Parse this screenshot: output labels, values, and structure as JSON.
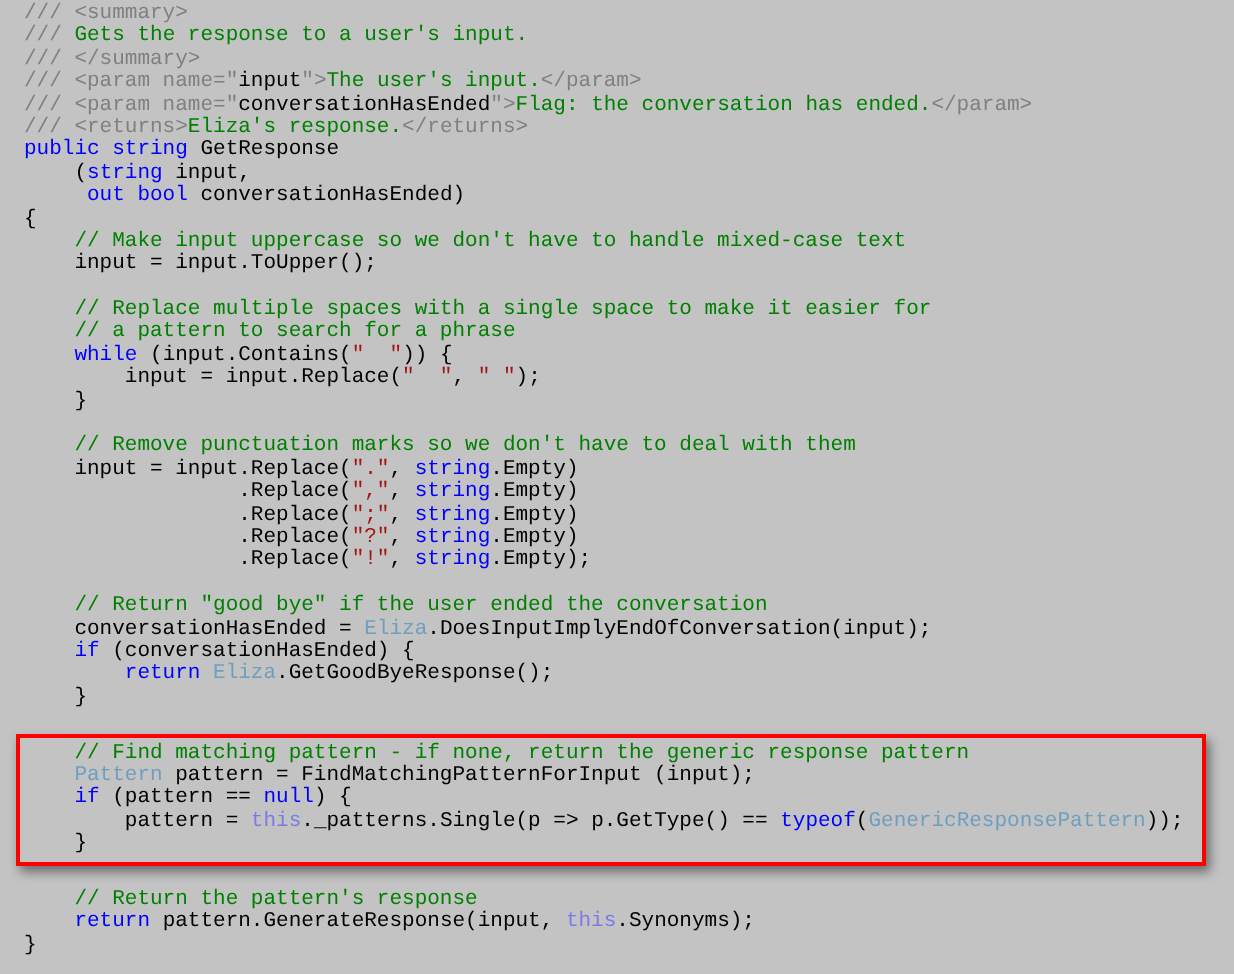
{
  "editor": {
    "sections": [
      {
        "highlighted": false,
        "lines": [
          {
            "kind": "code",
            "tokens": [
              {
                "kind": "doc",
                "text": "/// <summary>"
              }
            ]
          },
          {
            "kind": "code",
            "tokens": [
              {
                "kind": "doc",
                "text": "///"
              },
              {
                "kind": "comment",
                "text": " Gets the response to a user's input."
              }
            ]
          },
          {
            "kind": "code",
            "tokens": [
              {
                "kind": "doc",
                "text": "/// </summary>"
              }
            ]
          },
          {
            "kind": "code",
            "tokens": [
              {
                "kind": "doc",
                "text": "/// <param name=\""
              },
              {
                "kind": "plain",
                "text": "input"
              },
              {
                "kind": "doc",
                "text": "\">"
              },
              {
                "kind": "comment",
                "text": "The user's input."
              },
              {
                "kind": "doc",
                "text": "</param>"
              }
            ]
          },
          {
            "kind": "code",
            "tokens": [
              {
                "kind": "doc",
                "text": "/// <param name=\""
              },
              {
                "kind": "plain",
                "text": "conversationHasEnded"
              },
              {
                "kind": "doc",
                "text": "\">"
              },
              {
                "kind": "comment",
                "text": "Flag: the conversation has ended."
              },
              {
                "kind": "doc",
                "text": "</param>"
              }
            ]
          },
          {
            "kind": "code",
            "tokens": [
              {
                "kind": "doc",
                "text": "/// <returns>"
              },
              {
                "kind": "comment",
                "text": "Eliza's response."
              },
              {
                "kind": "doc",
                "text": "</returns>"
              }
            ]
          },
          {
            "kind": "code",
            "tokens": [
              {
                "kind": "keyword",
                "text": "public string"
              },
              {
                "kind": "plain",
                "text": " GetResponse"
              }
            ]
          },
          {
            "kind": "code",
            "tokens": [
              {
                "kind": "plain",
                "text": "    ("
              },
              {
                "kind": "keyword",
                "text": "string"
              },
              {
                "kind": "plain",
                "text": " input,"
              }
            ]
          },
          {
            "kind": "code",
            "tokens": [
              {
                "kind": "keyword",
                "text": "     out bool"
              },
              {
                "kind": "plain",
                "text": " conversationHasEnded)"
              }
            ]
          },
          {
            "kind": "code",
            "tokens": [
              {
                "kind": "plain",
                "text": "{"
              }
            ]
          },
          {
            "kind": "code",
            "tokens": [
              {
                "kind": "comment",
                "text": "    // Make input uppercase so we don't have to handle mixed-case text"
              }
            ]
          },
          {
            "kind": "code",
            "tokens": [
              {
                "kind": "plain",
                "text": "    input = input.ToUpper();"
              }
            ]
          },
          {
            "kind": "blank"
          },
          {
            "kind": "code",
            "tokens": [
              {
                "kind": "comment",
                "text": "    // Replace multiple spaces with a single space to make it easier for"
              }
            ]
          },
          {
            "kind": "code",
            "tokens": [
              {
                "kind": "comment",
                "text": "    // a pattern to search for a phrase"
              }
            ]
          },
          {
            "kind": "code",
            "tokens": [
              {
                "kind": "keyword",
                "text": "    while"
              },
              {
                "kind": "plain",
                "text": " (input.Contains("
              },
              {
                "kind": "string",
                "text": "\"  \""
              },
              {
                "kind": "plain",
                "text": ")) {"
              }
            ]
          },
          {
            "kind": "code",
            "tokens": [
              {
                "kind": "plain",
                "text": "        input = input.Replace("
              },
              {
                "kind": "string",
                "text": "\"  \""
              },
              {
                "kind": "plain",
                "text": ", "
              },
              {
                "kind": "string",
                "text": "\" \""
              },
              {
                "kind": "plain",
                "text": ");"
              }
            ]
          },
          {
            "kind": "code",
            "tokens": [
              {
                "kind": "plain",
                "text": "    }"
              }
            ]
          },
          {
            "kind": "blank"
          },
          {
            "kind": "code",
            "tokens": [
              {
                "kind": "comment",
                "text": "    // Remove punctuation marks so we don't have to deal with them"
              }
            ]
          },
          {
            "kind": "code",
            "tokens": [
              {
                "kind": "plain",
                "text": "    input = input.Replace("
              },
              {
                "kind": "string",
                "text": "\".\""
              },
              {
                "kind": "plain",
                "text": ", "
              },
              {
                "kind": "keyword",
                "text": "string"
              },
              {
                "kind": "plain",
                "text": ".Empty)"
              }
            ]
          },
          {
            "kind": "code",
            "tokens": [
              {
                "kind": "plain",
                "text": "                 .Replace("
              },
              {
                "kind": "string",
                "text": "\",\""
              },
              {
                "kind": "plain",
                "text": ", "
              },
              {
                "kind": "keyword",
                "text": "string"
              },
              {
                "kind": "plain",
                "text": ".Empty)"
              }
            ]
          },
          {
            "kind": "code",
            "tokens": [
              {
                "kind": "plain",
                "text": "                 .Replace("
              },
              {
                "kind": "string",
                "text": "\";\""
              },
              {
                "kind": "plain",
                "text": ", "
              },
              {
                "kind": "keyword",
                "text": "string"
              },
              {
                "kind": "plain",
                "text": ".Empty)"
              }
            ]
          },
          {
            "kind": "code",
            "tokens": [
              {
                "kind": "plain",
                "text": "                 .Replace("
              },
              {
                "kind": "string",
                "text": "\"?\""
              },
              {
                "kind": "plain",
                "text": ", "
              },
              {
                "kind": "keyword",
                "text": "string"
              },
              {
                "kind": "plain",
                "text": ".Empty)"
              }
            ]
          },
          {
            "kind": "code",
            "tokens": [
              {
                "kind": "plain",
                "text": "                 .Replace("
              },
              {
                "kind": "string",
                "text": "\"!\""
              },
              {
                "kind": "plain",
                "text": ", "
              },
              {
                "kind": "keyword",
                "text": "string"
              },
              {
                "kind": "plain",
                "text": ".Empty);"
              }
            ]
          },
          {
            "kind": "blank"
          },
          {
            "kind": "code",
            "tokens": [
              {
                "kind": "comment",
                "text": "    // Return \"good bye\" if the user ended the conversation"
              }
            ]
          },
          {
            "kind": "code",
            "tokens": [
              {
                "kind": "plain",
                "text": "    conversationHasEnded = "
              },
              {
                "kind": "type",
                "text": "Eliza"
              },
              {
                "kind": "plain",
                "text": ".DoesInputImplyEndOfConversation(input);"
              }
            ]
          },
          {
            "kind": "code",
            "tokens": [
              {
                "kind": "keyword",
                "text": "    if"
              },
              {
                "kind": "plain",
                "text": " (conversationHasEnded) {"
              }
            ]
          },
          {
            "kind": "code",
            "tokens": [
              {
                "kind": "keyword",
                "text": "        return"
              },
              {
                "kind": "type",
                "text": " Eliza"
              },
              {
                "kind": "plain",
                "text": ".GetGoodByeResponse();"
              }
            ]
          },
          {
            "kind": "code",
            "tokens": [
              {
                "kind": "plain",
                "text": "    }"
              }
            ]
          },
          {
            "kind": "blank"
          }
        ]
      },
      {
        "highlighted": true,
        "lines": [
          {
            "kind": "code",
            "tokens": [
              {
                "kind": "comment",
                "text": "    // Find matching pattern - if none, return the generic response pattern"
              }
            ]
          },
          {
            "kind": "code",
            "tokens": [
              {
                "kind": "type",
                "text": "    Pattern"
              },
              {
                "kind": "plain",
                "text": " pattern = FindMatchingPatternForInput (input);"
              }
            ]
          },
          {
            "kind": "code",
            "tokens": [
              {
                "kind": "keyword",
                "text": "    if"
              },
              {
                "kind": "plain",
                "text": " (pattern == "
              },
              {
                "kind": "keyword",
                "text": "null"
              },
              {
                "kind": "plain",
                "text": ") {"
              }
            ]
          },
          {
            "kind": "code",
            "tokens": [
              {
                "kind": "plain",
                "text": "        pattern = "
              },
              {
                "kind": "this",
                "text": "this"
              },
              {
                "kind": "plain",
                "text": "._patterns.Single(p => p.GetType() == "
              },
              {
                "kind": "keyword",
                "text": "typeof"
              },
              {
                "kind": "plain",
                "text": "("
              },
              {
                "kind": "type",
                "text": "GenericResponsePattern"
              },
              {
                "kind": "plain",
                "text": "));"
              }
            ]
          },
          {
            "kind": "code",
            "tokens": [
              {
                "kind": "plain",
                "text": "    }"
              }
            ]
          }
        ]
      },
      {
        "highlighted": false,
        "lines": [
          {
            "kind": "blank"
          },
          {
            "kind": "code",
            "tokens": [
              {
                "kind": "comment",
                "text": "    // Return the pattern's response"
              }
            ]
          },
          {
            "kind": "code",
            "tokens": [
              {
                "kind": "keyword",
                "text": "    return"
              },
              {
                "kind": "plain",
                "text": " pattern.GenerateResponse(input, "
              },
              {
                "kind": "this",
                "text": "this"
              },
              {
                "kind": "plain",
                "text": ".Synonyms);"
              }
            ]
          },
          {
            "kind": "code",
            "tokens": [
              {
                "kind": "plain",
                "text": "}"
              }
            ]
          }
        ]
      }
    ]
  }
}
